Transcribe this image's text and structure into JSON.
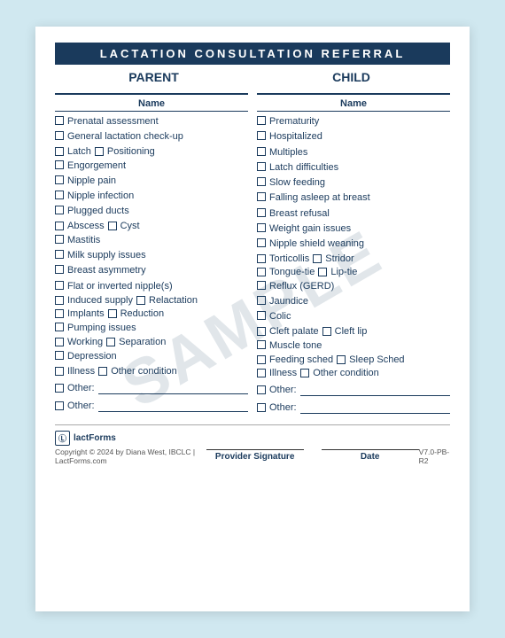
{
  "header": {
    "title": "LACTATION CONSULTATION REFERRAL",
    "col1_title": "PARENT",
    "col2_title": "CHILD"
  },
  "columns": {
    "col1": {
      "name_label": "Name",
      "items": [
        {
          "type": "single",
          "label": "Prenatal assessment"
        },
        {
          "type": "single",
          "label": "General lactation check-up"
        },
        {
          "type": "double",
          "label1": "Latch",
          "label2": "Positioning"
        },
        {
          "type": "single",
          "label": "Engorgement"
        },
        {
          "type": "single",
          "label": "Nipple pain"
        },
        {
          "type": "single",
          "label": "Nipple infection"
        },
        {
          "type": "single",
          "label": "Plugged ducts"
        },
        {
          "type": "double",
          "label1": "Abscess",
          "label2": "Cyst"
        },
        {
          "type": "single",
          "label": "Mastitis"
        },
        {
          "type": "single",
          "label": "Milk supply issues"
        },
        {
          "type": "single",
          "label": "Breast asymmetry"
        },
        {
          "type": "single",
          "label": "Flat or inverted nipple(s)"
        },
        {
          "type": "double",
          "label1": "Induced supply",
          "label2": "Relactation"
        },
        {
          "type": "double",
          "label1": "Implants",
          "label2": "Reduction"
        },
        {
          "type": "single",
          "label": "Pumping issues"
        },
        {
          "type": "double",
          "label1": "Working",
          "label2": "Separation"
        },
        {
          "type": "single",
          "label": "Depression"
        },
        {
          "type": "double",
          "label1": "Illness",
          "label2": "Other condition"
        }
      ],
      "other1_label": "Other:",
      "other2_label": "Other:"
    },
    "col2": {
      "name_label": "Name",
      "items": [
        {
          "type": "single",
          "label": "Prematurity"
        },
        {
          "type": "single",
          "label": "Hospitalized"
        },
        {
          "type": "single",
          "label": "Multiples"
        },
        {
          "type": "single",
          "label": "Latch difficulties"
        },
        {
          "type": "single",
          "label": "Slow feeding"
        },
        {
          "type": "single",
          "label": "Falling asleep at breast"
        },
        {
          "type": "single",
          "label": "Breast refusal"
        },
        {
          "type": "single",
          "label": "Weight gain issues"
        },
        {
          "type": "single",
          "label": "Nipple shield weaning"
        },
        {
          "type": "double",
          "label1": "Torticollis",
          "label2": "Stridor"
        },
        {
          "type": "double",
          "label1": "Tongue-tie",
          "label2": "Lip-tie"
        },
        {
          "type": "single",
          "label": "Reflux (GERD)"
        },
        {
          "type": "single",
          "label": "Jaundice"
        },
        {
          "type": "single",
          "label": "Colic"
        },
        {
          "type": "double",
          "label1": "Cleft palate",
          "label2": "Cleft lip"
        },
        {
          "type": "single",
          "label": "Muscle tone"
        },
        {
          "type": "double",
          "label1": "Feeding sched",
          "label2": "Sleep Sched"
        },
        {
          "type": "double",
          "label1": "Illness",
          "label2": "Other condition"
        }
      ],
      "other1_label": "Other:",
      "other2_label": "Other:"
    }
  },
  "footer": {
    "logo_icon": "🄻",
    "logo_text": "lactForms",
    "copyright": "Copyright © 2024 by Diana West, IBCLC | LactForms.com",
    "version": "V7.0-PB-R2",
    "sig_label": "Provider Signature",
    "date_label": "Date"
  },
  "watermark": "SAMPLE"
}
